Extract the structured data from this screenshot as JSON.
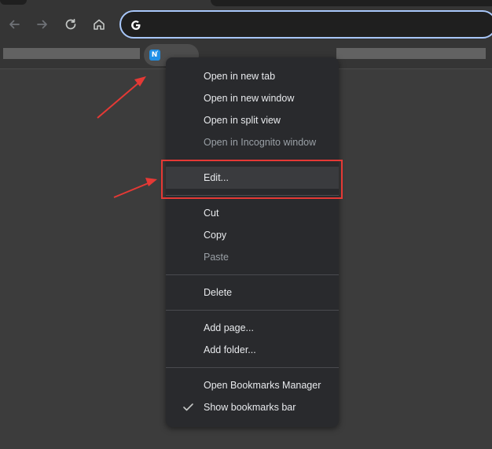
{
  "window": {
    "omnibox": {
      "value": "",
      "engine_icon": "google-g-icon"
    }
  },
  "toolbar": {
    "back_icon": "arrow-left-icon",
    "forward_icon": "arrow-right-icon",
    "reload_icon": "reload-icon",
    "home_icon": "home-icon"
  },
  "bookmarks_bar": {
    "active_bookmark": {
      "favicon_text": "N",
      "favicon_name": "notion-icon"
    }
  },
  "context_menu": {
    "items": [
      {
        "label": "Open in new tab",
        "disabled": false
      },
      {
        "label": "Open in new window",
        "disabled": false
      },
      {
        "label": "Open in split view",
        "disabled": false
      },
      {
        "label": "Open in Incognito window",
        "disabled": true
      },
      {
        "label": "Edit...",
        "disabled": false,
        "highlighted": true
      },
      {
        "label": "Cut",
        "disabled": false
      },
      {
        "label": "Copy",
        "disabled": false
      },
      {
        "label": "Paste",
        "disabled": true
      },
      {
        "label": "Delete",
        "disabled": false
      },
      {
        "label": "Add page...",
        "disabled": false
      },
      {
        "label": "Add folder...",
        "disabled": false
      },
      {
        "label": "Open Bookmarks Manager",
        "disabled": false
      },
      {
        "label": "Show bookmarks bar",
        "disabled": false,
        "checked": true
      }
    ]
  },
  "annotations": {
    "highlight_color": "#e53935",
    "arrow_color": "#e53935"
  },
  "colors": {
    "page_bg": "#3c3c3c",
    "toolbar_bg": "#353535",
    "menu_bg": "#292a2d",
    "focus_ring": "#a8c7fa"
  }
}
